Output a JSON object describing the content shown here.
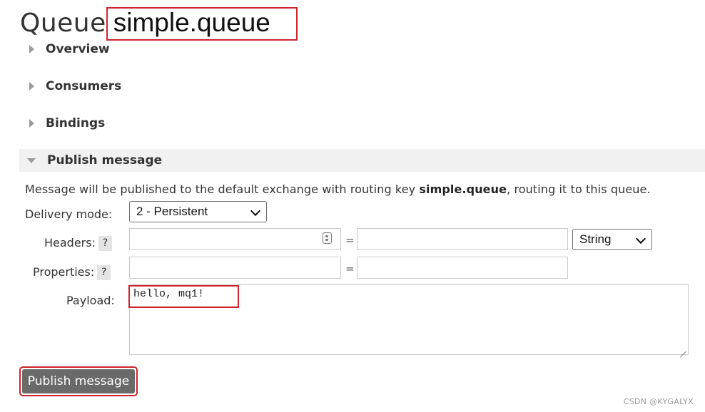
{
  "page": {
    "title_prefix": "Queue",
    "queue_name": "simple.queue"
  },
  "sections": {
    "overview": "Overview",
    "consumers": "Consumers",
    "bindings": "Bindings",
    "publish": "Publish message"
  },
  "publish": {
    "info_prefix": "Message will be published to the default exchange with routing key ",
    "routing_key": "simple.queue",
    "info_suffix": ", routing it to this queue.",
    "delivery_mode_label": "Delivery mode:",
    "delivery_mode_value": "2 - Persistent",
    "headers_label": "Headers:",
    "headers_type": "String",
    "properties_label": "Properties:",
    "help_mark": "?",
    "equals": "=",
    "payload_label": "Payload:",
    "payload_value": "hello, mq1!",
    "submit_label": "Publish message"
  },
  "watermark": "CSDN @KYGALYX",
  "colors": {
    "highlight": "#d0232e",
    "button_bg": "#6a6a6a",
    "section_bg": "#f1f1f1"
  }
}
